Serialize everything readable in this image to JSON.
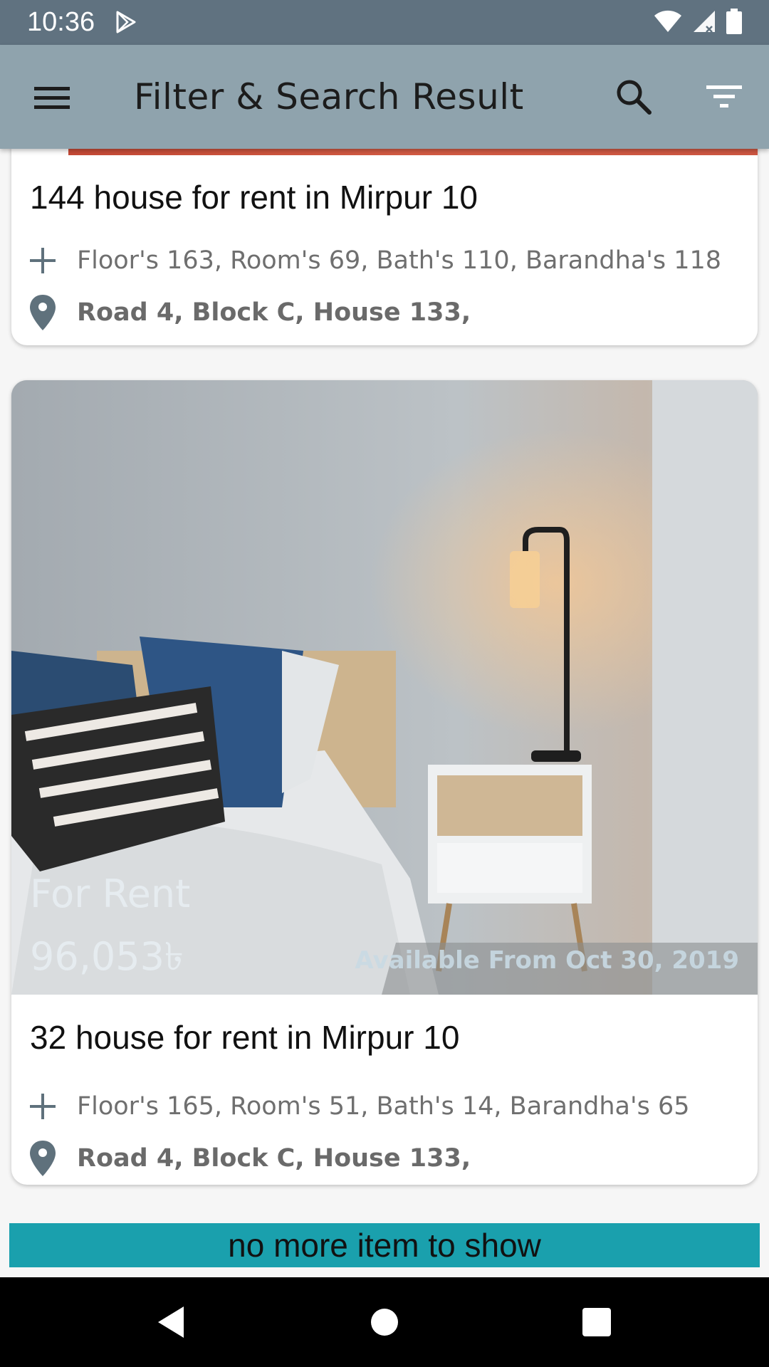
{
  "status_bar": {
    "time": "10:36",
    "icons": [
      "play-store-icon",
      "wifi-icon",
      "signal-icon",
      "battery-icon"
    ]
  },
  "app_bar": {
    "title": "Filter & Search Result",
    "icons": [
      "menu-icon",
      "search-icon",
      "filter-icon"
    ]
  },
  "listings": [
    {
      "title": "144 house for rent in Mirpur 10",
      "specs": "Floor's 163, Room's 69, Bath's 110, Barandha's 118",
      "address": "Road 4, Block C, House 133,"
    },
    {
      "title": "32 house for rent in Mirpur 10",
      "specs": "Floor's 165, Room's 51, Bath's 14, Barandha's 65",
      "address": "Road 4, Block C, House 133,",
      "type_label": "For Rent",
      "price": "96,053৳",
      "available": "Available From Oct 30, 2019"
    }
  ],
  "footer": {
    "message": "no more item to show"
  },
  "colors": {
    "status_bar": "#607280",
    "app_bar": "#8fa3ad",
    "banner": "#1aa0ad",
    "icon_gray": "#5f717c"
  }
}
